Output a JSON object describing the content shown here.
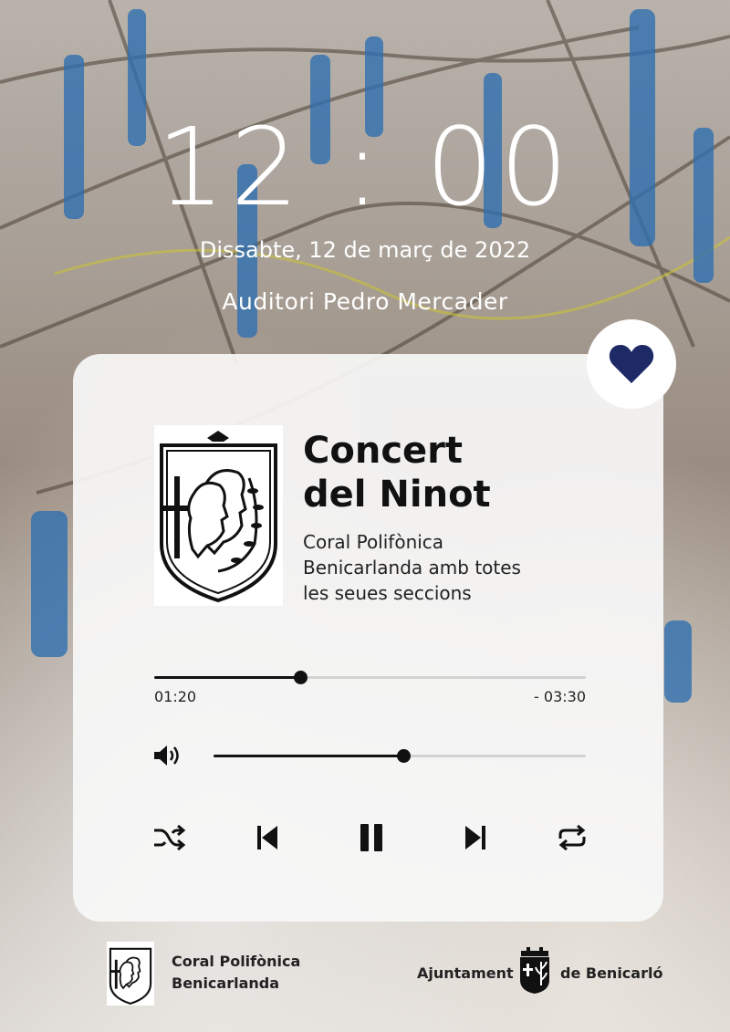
{
  "clock": {
    "time": "12 : 00"
  },
  "event": {
    "date": "Dissabte, 12 de març de 2022",
    "venue": "Auditori Pedro Mercader"
  },
  "player": {
    "title_line1": "Concert",
    "title_line2": "del Ninot",
    "subtitle_line1": "Coral Polifònica",
    "subtitle_line2": "Benicarlanda amb totes",
    "subtitle_line3": "les seues seccions",
    "elapsed": "01:20",
    "remaining": "- 03:30",
    "progress_fraction": 0.338,
    "volume_fraction": 0.51,
    "liked": true,
    "accent_color": "#1d2a66"
  },
  "controls": {
    "icons": [
      "shuffle-icon",
      "previous-icon",
      "pause-icon",
      "next-icon",
      "repeat-icon",
      "volume-icon",
      "heart-icon"
    ]
  },
  "footer": {
    "left_line1": "Coral Polifònica",
    "left_line2": "Benicarlanda",
    "right_before": "Ajuntament",
    "right_after": "de Benicarló"
  }
}
